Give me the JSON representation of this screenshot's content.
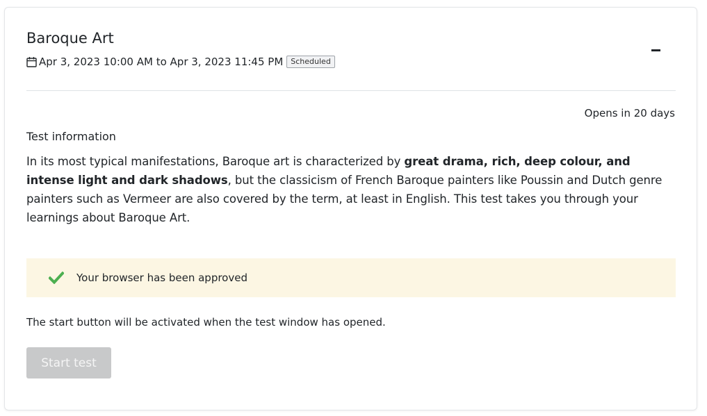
{
  "test": {
    "title": "Baroque Art",
    "schedule": "Apr 3, 2023 10:00 AM to Apr 3, 2023 11:45 PM",
    "status_badge": "Scheduled",
    "opens_in": "Opens in 20 days"
  },
  "info": {
    "heading": "Test information",
    "desc_part1": "In its most typical manifestations, Baroque art is characterized by ",
    "desc_bold": "great drama, rich, deep colour, and intense light and dark shadows",
    "desc_part2": ", but the classicism of French Baroque painters like Poussin and Dutch genre painters such as Vermeer are also covered by the term, at least in English. This test takes you through your learnings about Baroque Art."
  },
  "browser_check": {
    "message": "Your browser has been approved",
    "icon": "check-icon"
  },
  "footer": {
    "note": "The start button will be activated when the test window has opened.",
    "start_label": "Start test"
  },
  "colors": {
    "alert_bg": "#fcf6e3",
    "check_green": "#4caf50",
    "disabled_button": "#c8c9ca"
  }
}
